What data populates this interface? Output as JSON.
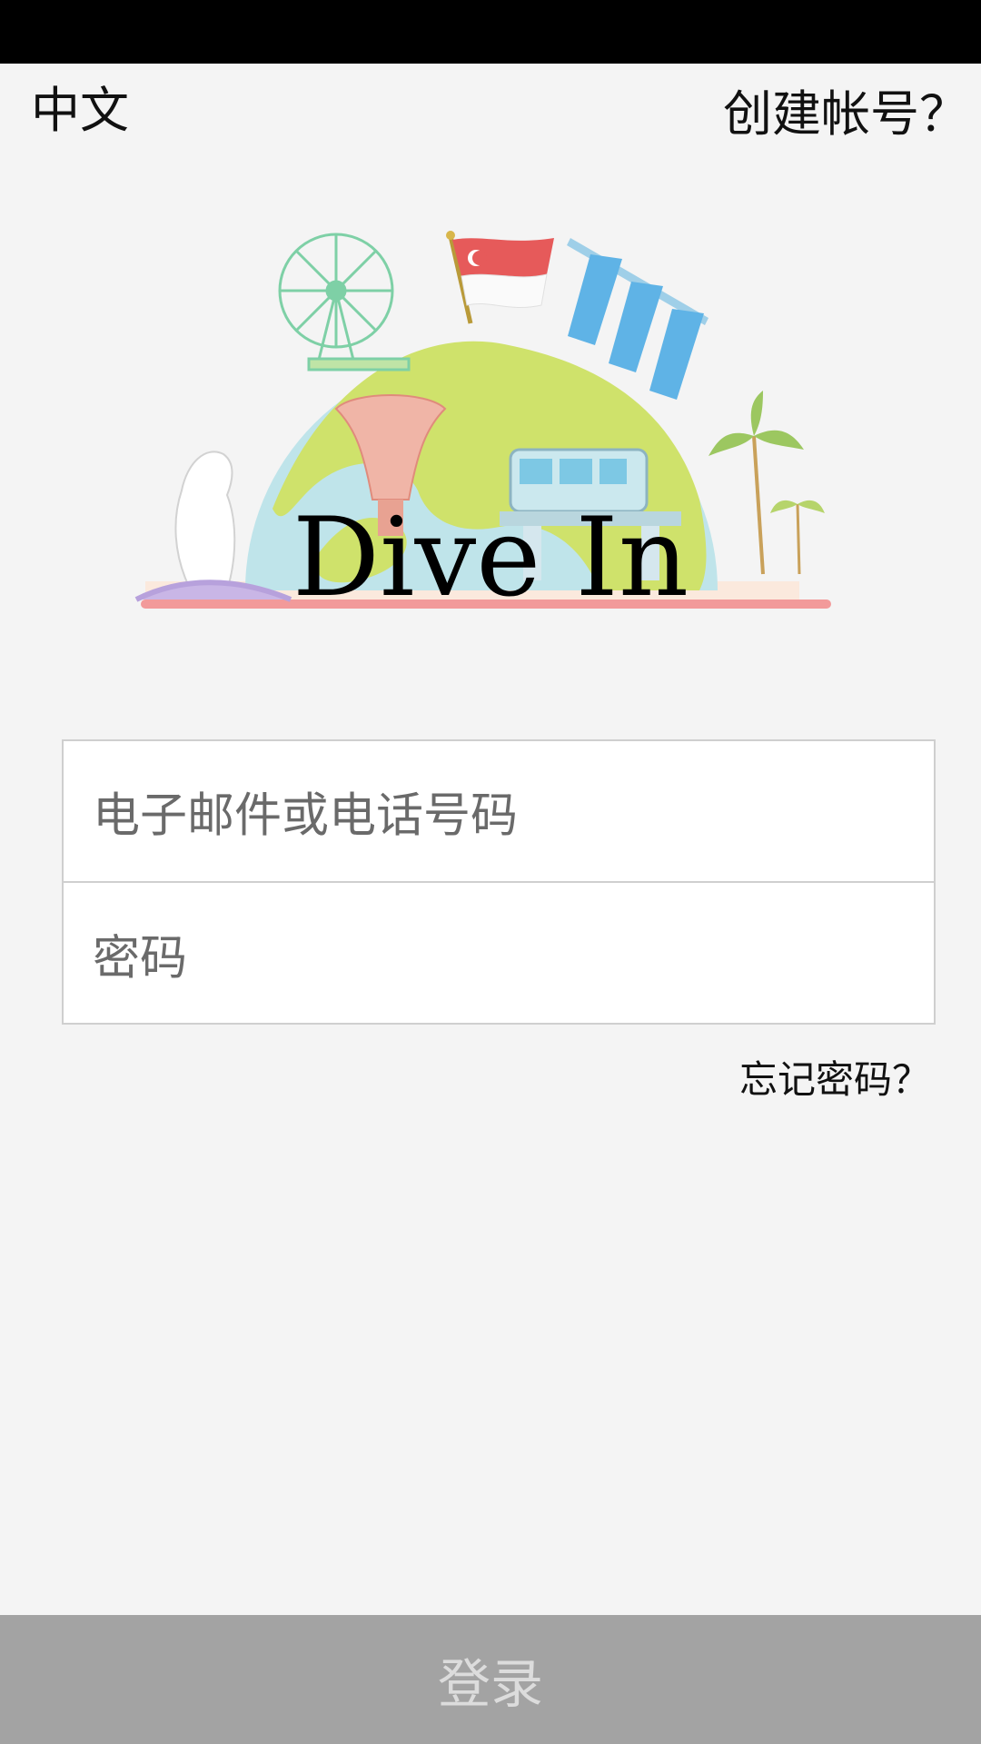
{
  "top_bar": {
    "language": "中文",
    "create_account": "创建帐号？"
  },
  "hero": {
    "title": "Dive In"
  },
  "form": {
    "email_placeholder": "电子邮件或电话号码",
    "password_placeholder": "密码"
  },
  "links": {
    "forgot_password": "忘记密码？"
  },
  "actions": {
    "login": "登录"
  },
  "colors": {
    "background": "#f4f4f4",
    "status_bar": "#000000",
    "login_bar": "#a3a3a3",
    "field_border": "#cfcfcf"
  }
}
